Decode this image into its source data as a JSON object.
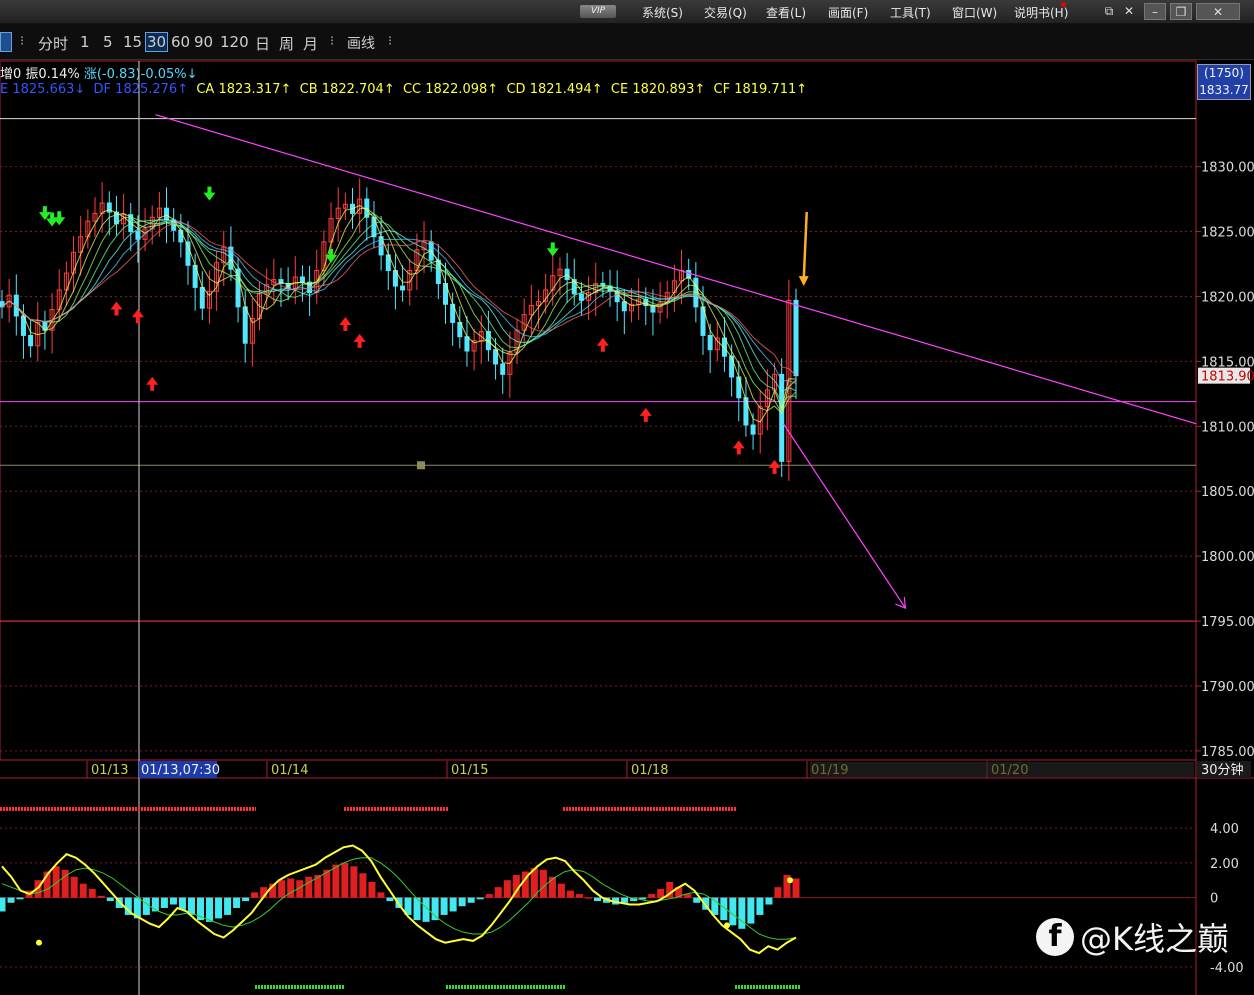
{
  "titlebar": {
    "vip": "VIP",
    "menu": [
      "系统(S)",
      "交易(Q)",
      "查看(L)",
      "画面(F)",
      "工具(T)",
      "窗口(W)",
      "说明书(H)"
    ],
    "controls": [
      "restore-small-icon",
      "close-small-icon",
      "minimize-icon",
      "restore-icon",
      "close-icon"
    ]
  },
  "toolbar": {
    "periods": [
      "分时",
      "1",
      "5",
      "15",
      "30",
      "60",
      "90",
      "120",
      "日",
      "周",
      "月"
    ],
    "active_period": "30",
    "sep": "⁝",
    "draw": "画线"
  },
  "info": {
    "line1": [
      {
        "text": "增0 振0.14%",
        "color": "white"
      },
      {
        "text": "涨(-0.83)-0.05%↓",
        "color": "cyan"
      }
    ],
    "line2": [
      {
        "text": "E 1825.663↓",
        "color": "blue"
      },
      {
        "text": "DF 1825.276↑",
        "color": "blue"
      },
      {
        "text": "CA 1823.317↑",
        "color": "yellow"
      },
      {
        "text": "CB 1822.704↑",
        "color": "yellow"
      },
      {
        "text": "CC 1822.098↑",
        "color": "yellow"
      },
      {
        "text": "CD 1821.494↑",
        "color": "yellow"
      },
      {
        "text": "CE 1820.893↑",
        "color": "yellow"
      },
      {
        "text": "CF 1819.711↑",
        "color": "yellow"
      }
    ],
    "right_box": [
      "(1750)",
      "1833.77"
    ]
  },
  "chart_data": [
    {
      "type": "candlestick",
      "title": "",
      "y_ticks": [
        1830,
        1825,
        1820,
        1815,
        1810,
        1805,
        1800,
        1795,
        1790,
        1785
      ],
      "y_tick_labels": [
        "1830.00",
        "1825.00",
        "1820.00",
        "1815.00",
        "1810.00",
        "1805.00",
        "1800.00",
        "1795.00",
        "1790.00",
        "1785.00"
      ],
      "ylim": [
        1784.3,
        1834.9
      ],
      "x_ticks": [
        "01/13",
        "01/14",
        "01/15",
        "01/18",
        "01/19",
        "01/20"
      ],
      "crosshair_label": "01/13,07:30",
      "period_label": "30分钟",
      "last_price": 1813.9,
      "last_price_label": "1813.90",
      "horizontal_lines": [
        {
          "y": 1811.9,
          "color": "#ff44ff"
        },
        {
          "y": 1807.0,
          "color": "#8a8a6a"
        },
        {
          "y": 1795.0,
          "color": "#ff3344"
        },
        {
          "y": 1833.7,
          "color": "#dddddd"
        }
      ],
      "trendline": {
        "from": [
          0.13,
          1834.0
        ],
        "to": [
          1.0,
          1810.2
        ],
        "color": "#ff44ff"
      },
      "projection_arrow": {
        "from": [
          0.655,
          1810.2
        ],
        "to": [
          0.757,
          1796.0
        ],
        "color": "#ff44ff"
      },
      "highlight_arrow": {
        "x": 0.672,
        "from": 1826.5,
        "to": 1820.8,
        "color": "#ffb020"
      },
      "close_series": [
        1819.2,
        1820.1,
        1818.5,
        1817.0,
        1816.2,
        1818.0,
        1817.4,
        1819.0,
        1820.5,
        1821.8,
        1823.4,
        1824.6,
        1825.8,
        1826.4,
        1827.2,
        1826.5,
        1825.6,
        1826.3,
        1825.0,
        1824.4,
        1825.2,
        1826.1,
        1826.8,
        1825.9,
        1825.1,
        1824.2,
        1822.4,
        1820.7,
        1819.1,
        1820.4,
        1822.6,
        1823.8,
        1822.1,
        1819.2,
        1816.4,
        1818.3,
        1820.2,
        1820.9,
        1821.3,
        1821.0,
        1820.6,
        1821.5,
        1821.1,
        1820.3,
        1822.0,
        1824.2,
        1826.0,
        1826.8,
        1827.1,
        1826.4,
        1827.5,
        1826.1,
        1824.6,
        1823.2,
        1822.0,
        1820.8,
        1820.5,
        1822.0,
        1823.6,
        1824.2,
        1822.8,
        1821.0,
        1819.4,
        1818.0,
        1816.9,
        1815.8,
        1816.6,
        1817.3,
        1815.9,
        1814.8,
        1814.0,
        1815.7,
        1817.4,
        1818.6,
        1819.3,
        1819.6,
        1820.5,
        1821.6,
        1822.1,
        1821.3,
        1820.2,
        1819.7,
        1820.3,
        1821.0,
        1820.8,
        1820.4,
        1819.6,
        1818.9,
        1819.4,
        1819.8,
        1819.3,
        1818.8,
        1819.5,
        1820.3,
        1821.2,
        1822.0,
        1821.4,
        1819.2,
        1817.0,
        1815.9,
        1816.8,
        1815.4,
        1813.8,
        1812.2,
        1810.1,
        1809.4,
        1811.5,
        1812.8,
        1814.0,
        1807.3,
        1819.7,
        1813.9
      ],
      "buy_signals": [
        {
          "i": 16,
          "y": 1819.0
        },
        {
          "i": 19,
          "y": 1818.4
        },
        {
          "i": 21,
          "y": 1813.2
        },
        {
          "i": 48,
          "y": 1817.8
        },
        {
          "i": 50,
          "y": 1816.5
        },
        {
          "i": 84,
          "y": 1816.2
        },
        {
          "i": 90,
          "y": 1810.8
        },
        {
          "i": 103,
          "y": 1808.3
        },
        {
          "i": 108,
          "y": 1806.8
        }
      ],
      "sell_signals": [
        {
          "i": 6,
          "y": 1826.5
        },
        {
          "i": 7,
          "y": 1826.0
        },
        {
          "i": 8,
          "y": 1826.1
        },
        {
          "i": 29,
          "y": 1828.0
        },
        {
          "i": 46,
          "y": 1823.2
        },
        {
          "i": 77,
          "y": 1823.7
        }
      ]
    },
    {
      "type": "bar",
      "title": "",
      "y_ticks": [
        4,
        2,
        0,
        -4
      ],
      "y_tick_labels": [
        "4.00",
        "2.00",
        "0",
        "-4.00"
      ],
      "ylim": [
        -5.5,
        6.2
      ],
      "histogram": [
        -0.8,
        -0.3,
        -0.1,
        0.4,
        1.0,
        1.5,
        1.8,
        1.6,
        1.2,
        0.8,
        0.5,
        0.1,
        -0.2,
        -0.6,
        -1.0,
        -1.2,
        -1.0,
        -0.8,
        -0.6,
        -0.4,
        -0.7,
        -1.0,
        -1.3,
        -1.4,
        -1.2,
        -1.0,
        -0.6,
        -0.2,
        0.3,
        0.6,
        0.8,
        1.0,
        1.1,
        1.0,
        1.2,
        1.3,
        1.6,
        1.9,
        2.0,
        1.8,
        1.4,
        0.9,
        0.3,
        -0.2,
        -0.6,
        -1.0,
        -1.3,
        -1.4,
        -1.3,
        -1.0,
        -0.8,
        -0.5,
        -0.3,
        -0.1,
        0.2,
        0.6,
        1.0,
        1.3,
        1.5,
        1.7,
        1.6,
        1.2,
        0.8,
        0.4,
        0.2,
        0.0,
        -0.2,
        -0.3,
        -0.4,
        -0.3,
        -0.2,
        -0.1,
        0.2,
        0.5,
        0.9,
        0.6,
        0.2,
        -0.3,
        -0.7,
        -1.0,
        -1.3,
        -1.6,
        -1.8,
        -1.5,
        -1.0,
        -0.4,
        0.6,
        1.3,
        1.1
      ],
      "dif": [
        1.8,
        1.2,
        0.4,
        0.2,
        0.6,
        1.4,
        2.0,
        2.5,
        2.3,
        1.9,
        1.4,
        0.8,
        0.2,
        -0.4,
        -0.9,
        -1.2,
        -1.5,
        -1.7,
        -1.2,
        -0.6,
        -0.8,
        -1.3,
        -1.7,
        -2.1,
        -2.3,
        -1.9,
        -1.4,
        -0.9,
        -0.2,
        0.5,
        1.0,
        1.3,
        1.5,
        1.7,
        1.9,
        2.3,
        2.6,
        2.9,
        3.0,
        2.7,
        2.1,
        1.2,
        0.4,
        -0.4,
        -1.1,
        -1.6,
        -2.0,
        -2.4,
        -2.6,
        -2.5,
        -2.4,
        -2.5,
        -2.2,
        -1.6,
        -0.9,
        -0.2,
        0.6,
        1.3,
        1.8,
        2.2,
        2.3,
        2.1,
        1.5,
        1.0,
        0.4,
        0.0,
        -0.2,
        -0.3,
        -0.4,
        -0.4,
        -0.3,
        -0.2,
        0.1,
        0.5,
        0.8,
        0.4,
        -0.3,
        -1.0,
        -1.6,
        -2.0,
        -2.4,
        -3.0,
        -3.2,
        -2.8,
        -3.0,
        -2.6,
        -2.3
      ],
      "dea": [
        0.8,
        0.6,
        0.4,
        0.2,
        0.3,
        0.5,
        0.9,
        1.3,
        1.6,
        1.7,
        1.6,
        1.4,
        1.1,
        0.7,
        0.3,
        -0.1,
        -0.5,
        -0.8,
        -1.0,
        -1.0,
        -0.9,
        -1.0,
        -1.2,
        -1.4,
        -1.6,
        -1.7,
        -1.6,
        -1.4,
        -1.1,
        -0.7,
        -0.2,
        0.2,
        0.5,
        0.8,
        1.1,
        1.4,
        1.7,
        2.0,
        2.2,
        2.3,
        2.3,
        2.0,
        1.6,
        1.1,
        0.5,
        -0.1,
        -0.6,
        -1.1,
        -1.5,
        -1.8,
        -2.0,
        -2.1,
        -2.1,
        -2.0,
        -1.7,
        -1.3,
        -0.8,
        -0.3,
        0.3,
        0.8,
        1.2,
        1.5,
        1.6,
        1.5,
        1.2,
        0.8,
        0.5,
        0.2,
        0.0,
        -0.1,
        -0.2,
        -0.2,
        -0.1,
        0.0,
        0.2,
        0.3,
        0.2,
        -0.1,
        -0.5,
        -0.9,
        -1.3,
        -1.7,
        -2.1,
        -2.3,
        -2.4,
        -2.4,
        -2.3
      ]
    }
  ],
  "watermark": {
    "icon": "f",
    "text": "@K线之巅"
  }
}
